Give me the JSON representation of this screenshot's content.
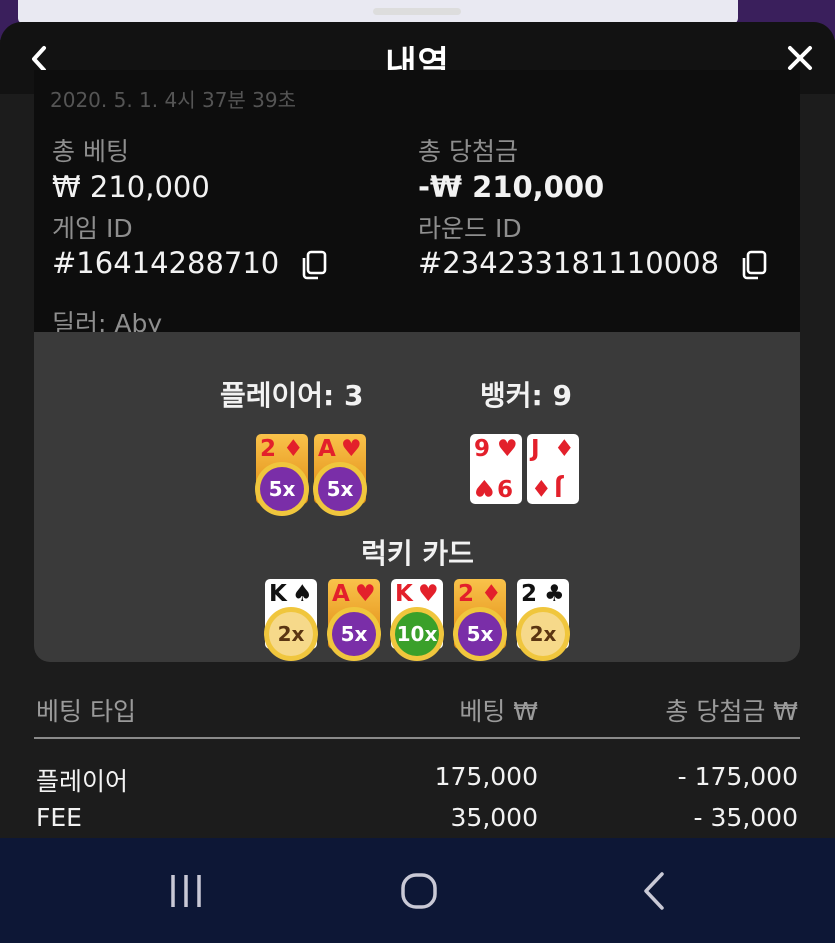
{
  "header": {
    "title": "내역"
  },
  "summary": {
    "timestamp_partial": "2020. 5. 1. 4시 37분 39초",
    "total_bet_label": "총 베팅",
    "total_bet_value": "₩ 210,000",
    "total_win_label": "총 당첨금",
    "total_win_value": "-₩ 210,000",
    "game_id_label": "게임 ID",
    "game_id_value": "#16414288710",
    "round_id_label": "라운드 ID",
    "round_id_value": "#234233181110008",
    "dealer_text": "딜러: Aby"
  },
  "result": {
    "player_label": "플레이어: 3",
    "banker_label": "뱅커: 9",
    "lucky_title": "럭키 카드",
    "player_cards": [
      {
        "rank": "2",
        "suit": "♦",
        "multiplier": "5x"
      },
      {
        "rank": "A",
        "suit": "♥",
        "multiplier": "5x"
      }
    ],
    "banker_cards": [
      {
        "rank": "9",
        "suit": "♥"
      },
      {
        "rank": "J",
        "suit": "♦"
      }
    ],
    "lucky_cards": [
      {
        "rank": "K",
        "suit": "♠",
        "multiplier": "2x"
      },
      {
        "rank": "A",
        "suit": "♥",
        "multiplier": "5x"
      },
      {
        "rank": "K",
        "suit": "♥",
        "multiplier": "10x"
      },
      {
        "rank": "2",
        "suit": "♦",
        "multiplier": "5x"
      },
      {
        "rank": "2",
        "suit": "♣",
        "multiplier": "2x"
      }
    ]
  },
  "bets_table": {
    "headers": [
      "베팅 타입",
      "베팅 ₩",
      "총 당첨금 ₩"
    ],
    "rows": [
      {
        "type": "플레이어",
        "bet": "175,000",
        "win": "- 175,000"
      },
      {
        "type": "FEE",
        "bet": "35,000",
        "win": "- 35,000"
      }
    ]
  },
  "colors": {
    "suit_red": "#e3202b",
    "badge_purple": "#7a2ea8",
    "badge_green": "#3aa02a",
    "badge_gold": "#f0c63d",
    "nav_bar": "#0d1736"
  }
}
